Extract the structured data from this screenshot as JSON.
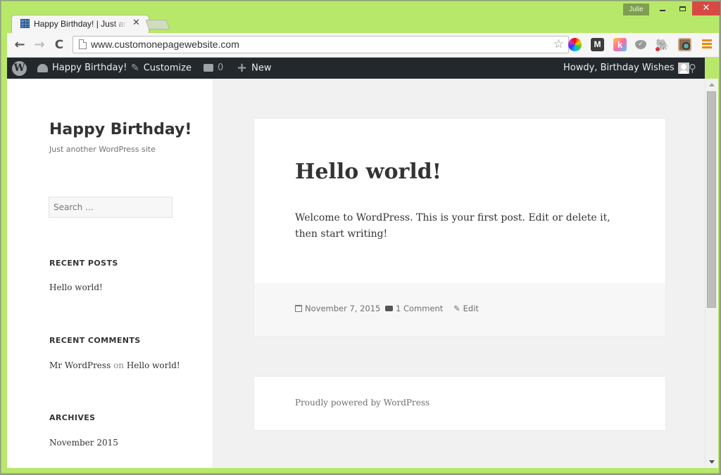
{
  "window": {
    "profile_name": "Julie",
    "minimize_label": "",
    "maximize_label": "",
    "close_label": "✕"
  },
  "tabs": [
    {
      "title": "Happy Birthday! | Just another WordPress site",
      "close": "✕",
      "active": true
    }
  ],
  "toolbar": {
    "back": "←",
    "forward": "→",
    "reload": "C",
    "url": "www.customonepagewebsite.com",
    "star": "☆",
    "extensions": [
      {
        "name": "color-wheel-extension",
        "label": ""
      },
      {
        "name": "m-extension",
        "label": "M"
      },
      {
        "name": "k-extension",
        "label": "k"
      },
      {
        "name": "pocket-extension",
        "label": "✓"
      },
      {
        "name": "evernote-extension",
        "label": "🐘"
      },
      {
        "name": "instagram-extension",
        "label": ""
      },
      {
        "name": "chrome-menu",
        "label": ""
      }
    ]
  },
  "adminbar": {
    "wp_logo": "W",
    "site_name": "Happy Birthday!",
    "customize": "Customize",
    "customize_icon": "✎",
    "comments_count": "0",
    "new_icon": "+",
    "new_label": "New",
    "howdy": "Howdy, Birthday Wishes",
    "search_icon": "⚲"
  },
  "sidebar": {
    "site_title": "Happy Birthday!",
    "site_description": "Just another WordPress site",
    "search_placeholder": "Search …",
    "widgets": {
      "recent_posts": {
        "title": "Recent Posts",
        "items": [
          "Hello world!"
        ]
      },
      "recent_comments": {
        "title": "Recent Comments",
        "author": "Mr WordPress",
        "connector": "on",
        "post": "Hello world!"
      },
      "archives": {
        "title": "Archives",
        "items": [
          "November 2015"
        ]
      }
    }
  },
  "post": {
    "title": "Hello world!",
    "body": "Welcome to WordPress. This is your first post. Edit or delete it, then start writing!",
    "date": "November 7, 2015",
    "comments": "1 Comment",
    "edit": "Edit",
    "edit_icon": "✎"
  },
  "footer": {
    "credit": "Proudly powered by WordPress"
  }
}
